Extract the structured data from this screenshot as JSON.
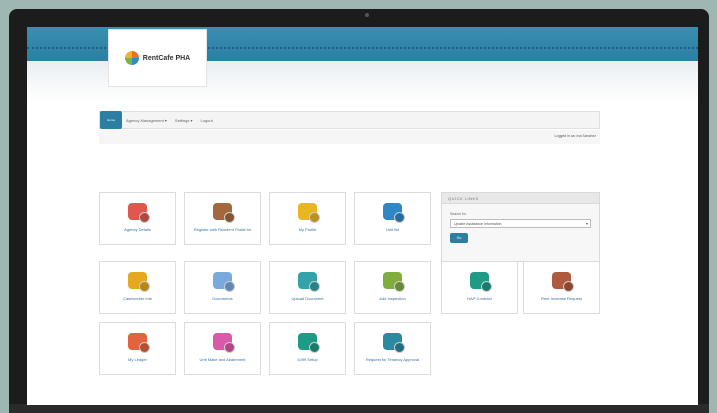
{
  "header": {
    "logo_text": "RentCafe PHA"
  },
  "nav": {
    "home": "Home",
    "items": [
      "Agency Management ▾",
      "Settings ▾",
      "Logout"
    ],
    "logged_in": "Logged in as: Ina Sanchez"
  },
  "tiles": [
    {
      "label": "Agency Details",
      "icon": "id-card-icon",
      "color": "#e0574f"
    },
    {
      "label": "Register with Resident Portal for",
      "icon": "users-clock-icon",
      "color": "#a5683d"
    },
    {
      "label": "My Profile",
      "icon": "profile-money-icon",
      "color": "#e9b61f"
    },
    {
      "label": "Unit list",
      "icon": "units-icon",
      "color": "#2f87c8"
    },
    {
      "label": "Caseworker Info",
      "icon": "caseworker-icon",
      "color": "#e5a820"
    },
    {
      "label": "Documents",
      "icon": "paperclip-icon",
      "color": "#7aa9dd"
    },
    {
      "label": "Upload Document",
      "icon": "upload-document-icon",
      "color": "#31a3a9"
    },
    {
      "label": "Add Inspection",
      "icon": "inspection-icon",
      "color": "#7fae3f"
    },
    {
      "label": "HAP Contract",
      "icon": "hap-contract-icon",
      "color": "#1f9a86"
    },
    {
      "label": "Rent Increase Request",
      "icon": "rent-increase-icon",
      "color": "#ad5a3f"
    },
    {
      "label": "My Ledger",
      "icon": "ledger-icon",
      "color": "#e2633f"
    },
    {
      "label": "Unit Make and Abatement",
      "icon": "make-abatement-icon",
      "color": "#d85aa8"
    },
    {
      "label": "1099 Setup",
      "icon": "tax-form-icon",
      "color": "#1f9a86"
    },
    {
      "label": "Request for Tenancy Approval",
      "icon": "tenancy-request-icon",
      "color": "#2c8aa0"
    }
  ],
  "quick_links": {
    "title": "QUICK LINKS",
    "subtitle": "Search for",
    "selected": "Update Assistance Information",
    "button": "Go"
  }
}
